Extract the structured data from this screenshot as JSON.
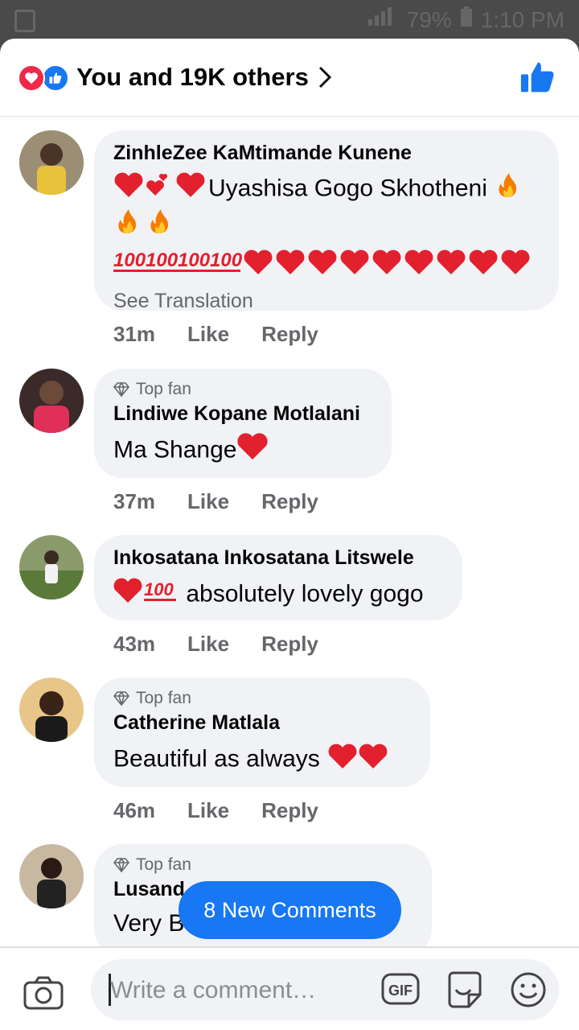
{
  "status": {
    "battery": "79%",
    "time": "1:10 PM"
  },
  "header": {
    "title": "You and 19K others"
  },
  "comments": [
    {
      "name": "ZinhleZee KaMtimande Kunene",
      "text_line1": "Uyashisa Gogo Skhotheni",
      "see_translation": "See Translation",
      "time": "31m"
    },
    {
      "badge": "Top fan",
      "name": "Lindiwe Kopane Motlalani",
      "text": "Ma Shange",
      "time": "37m"
    },
    {
      "name": "Inkosatana Inkosatana Litswele",
      "text": "absolutely lovely gogo",
      "time": "43m"
    },
    {
      "badge": "Top fan",
      "name": "Catherine Matlala",
      "text": "Beautiful as always",
      "time": "46m"
    },
    {
      "badge": "Top fan",
      "name": "Lusand",
      "text": "Very B"
    }
  ],
  "actions": {
    "like": "Like",
    "reply": "Reply"
  },
  "new_comments": "8 New Comments",
  "composer": {
    "placeholder": "Write a comment…"
  },
  "colors": {
    "accent": "#1877f2",
    "love": "#f0284a",
    "bubble": "#f0f2f5"
  }
}
